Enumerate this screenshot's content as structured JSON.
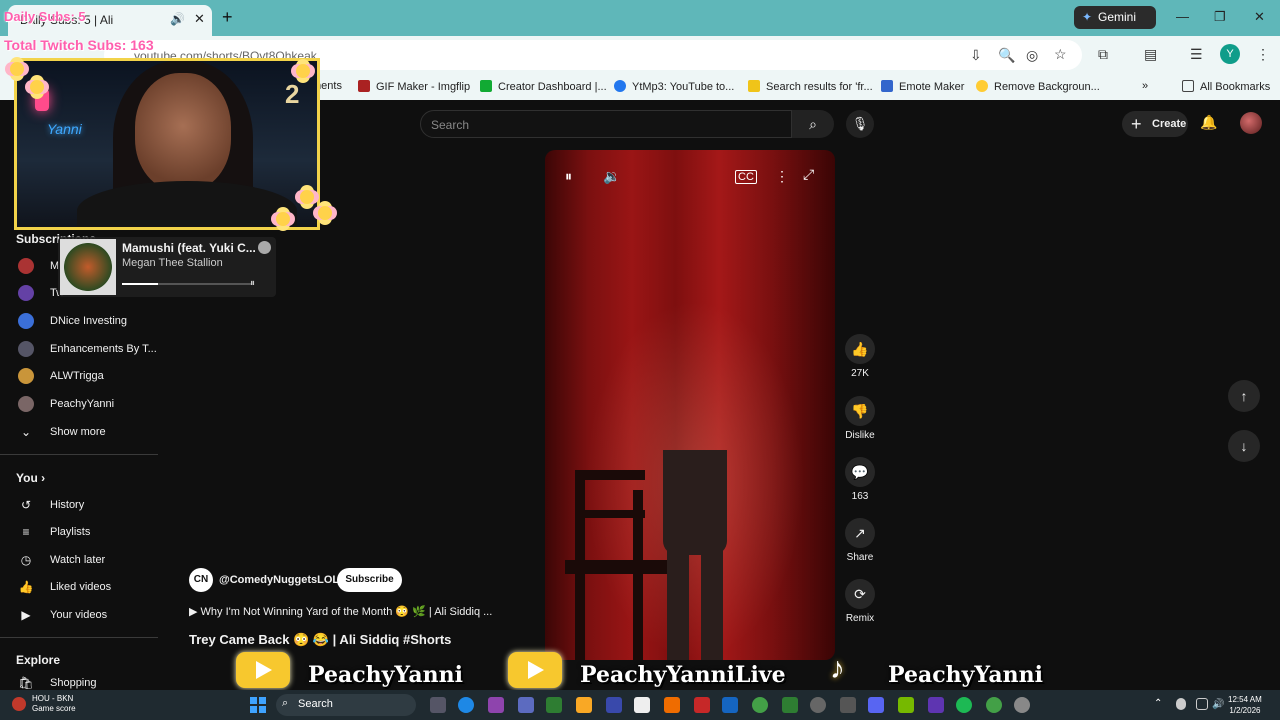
{
  "browser": {
    "tab_title": "Daily Subs: 5 | Ali",
    "gemini_label": "Gemini",
    "url": "youtube.com/shorts/BOvt8Qhkeak",
    "profile_initial": "Y",
    "bookmarks": [
      {
        "label": "ments",
        "color": "#cc3333"
      },
      {
        "label": "GIF Maker - Imgflip",
        "color": "#aa2222"
      },
      {
        "label": "Creator Dashboard |...",
        "color": "#11aa33"
      },
      {
        "label": "YtMp3: YouTube to...",
        "color": "#2277ee"
      },
      {
        "label": "Search results for 'fr...",
        "color": "#f0c419"
      },
      {
        "label": "Emote Maker",
        "color": "#3366cc"
      },
      {
        "label": "Remove Backgroun...",
        "color": "#ffcc33"
      }
    ],
    "all_bookmarks": "All Bookmarks"
  },
  "youtube": {
    "search_placeholder": "Search",
    "create_label": "Create",
    "sidebar": {
      "subscriptions_heading": "Subscriptions",
      "subscriptions": [
        {
          "label": "M",
          "icon": "avatar"
        },
        {
          "label": "Tw",
          "icon": "twitch-icon"
        },
        {
          "label": "DNice Investing",
          "icon": "avatar"
        },
        {
          "label": "Enhancements By T...",
          "icon": "avatar"
        },
        {
          "label": "ALWTrigga",
          "icon": "avatar"
        },
        {
          "label": "PeachyYanni",
          "icon": "avatar"
        }
      ],
      "show_more": "Show more",
      "you_heading": "You",
      "you_items": [
        {
          "label": "History",
          "icon": "history-icon"
        },
        {
          "label": "Playlists",
          "icon": "playlist-icon"
        },
        {
          "label": "Watch later",
          "icon": "clock-icon"
        },
        {
          "label": "Liked videos",
          "icon": "thumbs-up-icon"
        },
        {
          "label": "Your videos",
          "icon": "video-icon"
        }
      ],
      "explore_heading": "Explore",
      "explore_items": [
        {
          "label": "Shopping",
          "icon": "shopping-icon"
        }
      ]
    },
    "actions": {
      "likes": "27K",
      "dislike": "Dislike",
      "comments": "163",
      "share": "Share",
      "remix": "Remix"
    },
    "channel": {
      "name": "@ComedyNuggetsLOL",
      "logo_text": "CN",
      "subscribe": "Subscribe"
    },
    "sound_link": "Why I'm Not Winning Yard of the Month 😳 🌿 | Ali Siddiq ...",
    "video_title": "Trey Came Back 😳 😂 | Ali Siddiq #Shorts"
  },
  "overlay": {
    "daily_subs": "Daily Subs: 5",
    "total_subs": "Total Twitch Subs: 163",
    "webcam_neon": "Yanni",
    "spotify": {
      "song": "Mamushi (feat. Yuki C...",
      "artist": "Megan Thee Stallion",
      "progress": 0.28
    },
    "socials": [
      {
        "platform": "youtube",
        "handle": "PeachyYanni"
      },
      {
        "platform": "youtube",
        "handle": "PeachyYanniLive"
      },
      {
        "platform": "tiktok",
        "handle": "PeachyYanni"
      }
    ]
  },
  "taskbar": {
    "weather_line1": "HOU - BKN",
    "weather_line2": "Game score",
    "search_label": "Search",
    "time": "12:54 AM",
    "date": "1/2/2026"
  },
  "colors": {
    "tabbar": "#5fb7b9",
    "accent_yellow": "#f7c82e",
    "overlay_pink": "#ff5fae"
  }
}
